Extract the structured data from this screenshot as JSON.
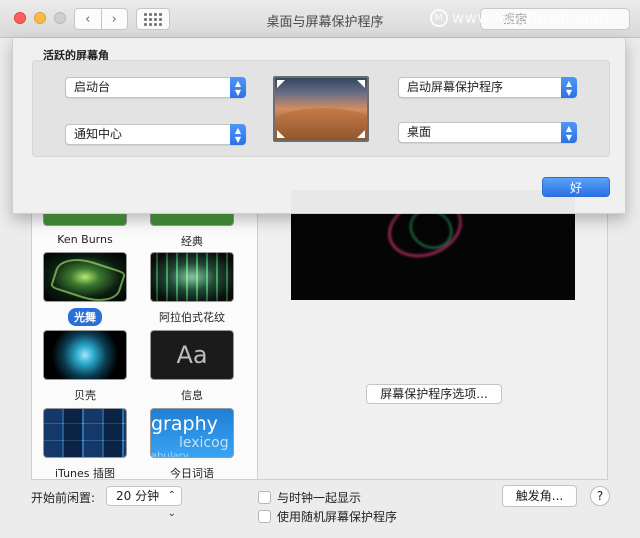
{
  "window": {
    "title": "桌面与屏幕保护程序",
    "search_placeholder": "搜索",
    "watermark": "www.MacDown.com"
  },
  "hot_corners_sheet": {
    "title": "活跃的屏幕角",
    "top_left": "启动台",
    "bottom_left": "通知中心",
    "top_right": "启动屏幕保护程序",
    "bottom_right": "桌面",
    "ok_label": "好"
  },
  "screensavers": [
    {
      "label": "Ken Burns"
    },
    {
      "label": "经典"
    },
    {
      "label": "光舞",
      "selected": true
    },
    {
      "label": "阿拉伯式花纹"
    },
    {
      "label": "贝壳"
    },
    {
      "label": "信息"
    },
    {
      "label": "iTunes 插图"
    },
    {
      "label": "今日词语"
    }
  ],
  "thumbs": {
    "word_sample": "Aa",
    "wotd_line1": "graphy",
    "wotd_line2": "lexicog",
    "wotd_line3": "abulary"
  },
  "preview": {
    "options_button": "屏幕保护程序选项..."
  },
  "bottom": {
    "idle_label": "开始前闲置:",
    "idle_value": "20 分钟",
    "show_clock": "与时钟一起显示",
    "random_saver": "使用随机屏幕保护程序",
    "hot_corners_button": "触发角...",
    "help": "?"
  },
  "icons": [
    "close-icon",
    "minimize-icon",
    "zoom-icon",
    "chevron-left-icon",
    "chevron-right-icon",
    "grid-icon",
    "search-icon",
    "stepper-icon"
  ]
}
